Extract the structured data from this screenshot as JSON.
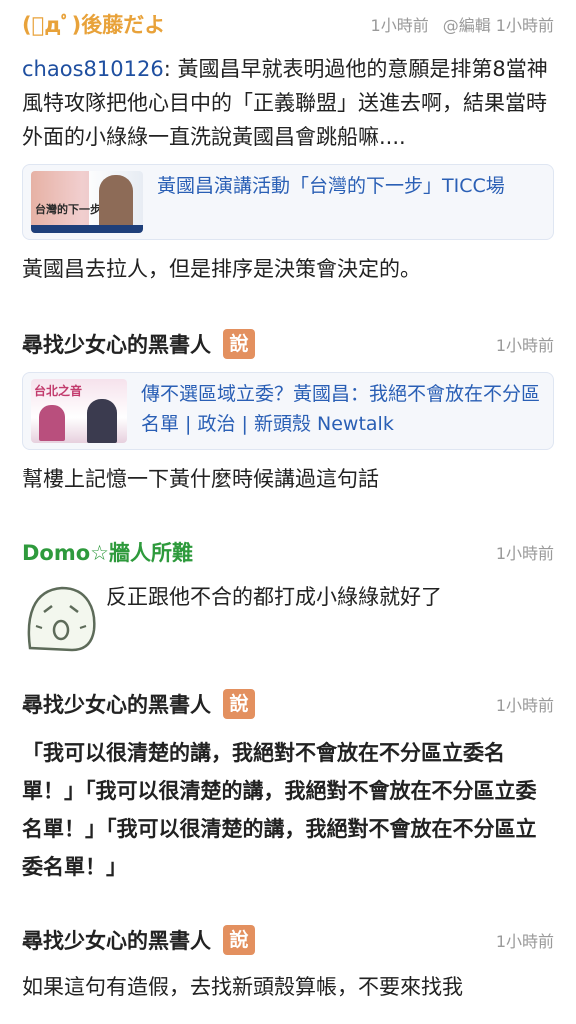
{
  "posts": [
    {
      "user": "(ﾟдﾟ)後藤だよ",
      "time": "1小時前",
      "edited": "@編輯 1小時前",
      "reply_to": "chaos810126",
      "quote": ": 黃國昌早就表明過他的意願是排第8當神風特攻隊把他心目中的「正義聯盟」送進去啊，結果當時外面的小綠綠一直洗說黃國昌會跳船嘛....",
      "link": {
        "title": "黃國昌演講活動「台灣的下一步」TICC場",
        "thumb_text": "台灣的下一步"
      },
      "text": "黃國昌去拉人，但是排序是決策會決定的。"
    },
    {
      "user": "尋找少女心的黑書人",
      "badge": "說",
      "time": "1小時前",
      "link": {
        "title": "傳不選區域立委？黃國昌：我絕不會放在不分區名單 | 政治 | 新頭殼 Newtalk",
        "thumb_text": "台北之音"
      },
      "text": "幫樓上記憶一下黃什麼時候講過這句話"
    },
    {
      "user": "Domo☆牆人所難",
      "time": "1小時前",
      "text": "反正跟他不合的都打成小綠綠就好了"
    },
    {
      "user": "尋找少女心的黑書人",
      "badge": "說",
      "time": "1小時前",
      "text": "「我可以很清楚的講，我絕對不會放在不分區立委名單！」「我可以很清楚的講，我絕對不會放在不分區立委名單！」「我可以很清楚的講，我絕對不會放在不分區立委名單！」"
    },
    {
      "user": "尋找少女心的黑書人",
      "badge": "說",
      "time": "1小時前",
      "text": "如果這句有造假，去找新頭殼算帳，不要來找我"
    }
  ],
  "colors": {
    "user_orange": "#e8a23a",
    "user_green": "#2e9a3c",
    "link_blue": "#2a5fb5",
    "badge": "#e3905f"
  }
}
